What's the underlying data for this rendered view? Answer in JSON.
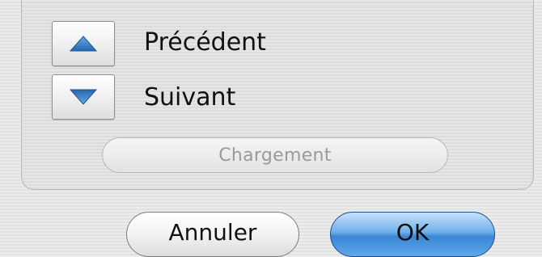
{
  "navigation": {
    "previous_label": "Précédent",
    "next_label": "Suivant",
    "up_icon": "arrow-up-icon",
    "down_icon": "arrow-down-icon"
  },
  "loading_button_label": "Chargement",
  "dialog_buttons": {
    "cancel_label": "Annuler",
    "ok_label": "OK"
  },
  "colors": {
    "arrow_blue": "#2f78c4",
    "ok_button_blue": "#3a86d4",
    "disabled_text": "#9a9a9a"
  }
}
